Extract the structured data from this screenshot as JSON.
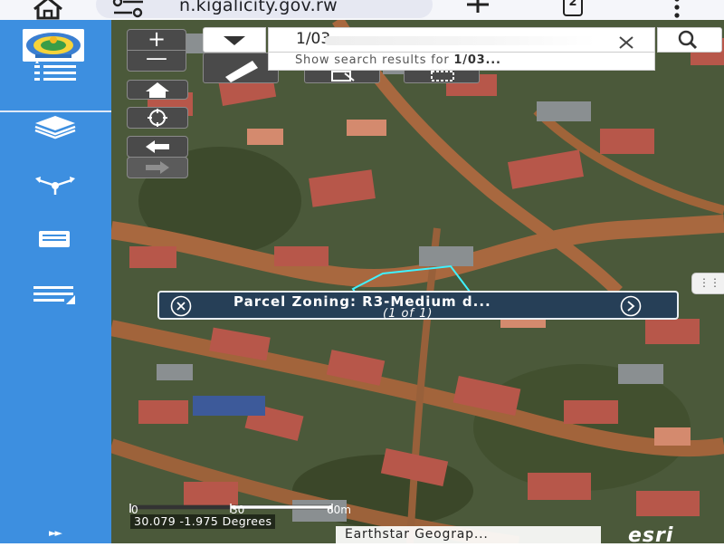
{
  "browser": {
    "url": "n.kigalicity.gov.rw",
    "tabs_count": "2",
    "icons": [
      "home-icon",
      "site-settings-icon",
      "new-tab-icon",
      "tabs-icon",
      "menu-icon"
    ]
  },
  "sidebar": {
    "accent": "#3d8fe0",
    "items": [
      {
        "name": "legend",
        "icon": "legend-list-icon"
      },
      {
        "name": "layers",
        "icon": "layers-icon"
      },
      {
        "name": "share",
        "icon": "share-icon"
      },
      {
        "name": "print",
        "icon": "print-icon"
      },
      {
        "name": "query",
        "icon": "query-list-icon"
      }
    ],
    "expand_glyph": "►►"
  },
  "map": {
    "zoom_in_label": "+",
    "zoom_out_label": "—",
    "search": {
      "value": "1/03",
      "suggestion_prefix": "Show search results for ",
      "suggestion_term": "1/03..."
    },
    "popup": {
      "title": "Parcel Zoning: R3-Medium d...",
      "count": "(1 of 1)"
    },
    "scale": {
      "ticks": [
        "0",
        "30",
        "60m"
      ]
    },
    "coordinates": "30.079 -1.975 Degrees",
    "attribution": "Earthstar Geograp...",
    "logo_text": "esri",
    "colors": {
      "popup_bg": "#263f57",
      "parcel_outline": "#3ff2ff",
      "control_bg": "#4a4a4a"
    }
  }
}
